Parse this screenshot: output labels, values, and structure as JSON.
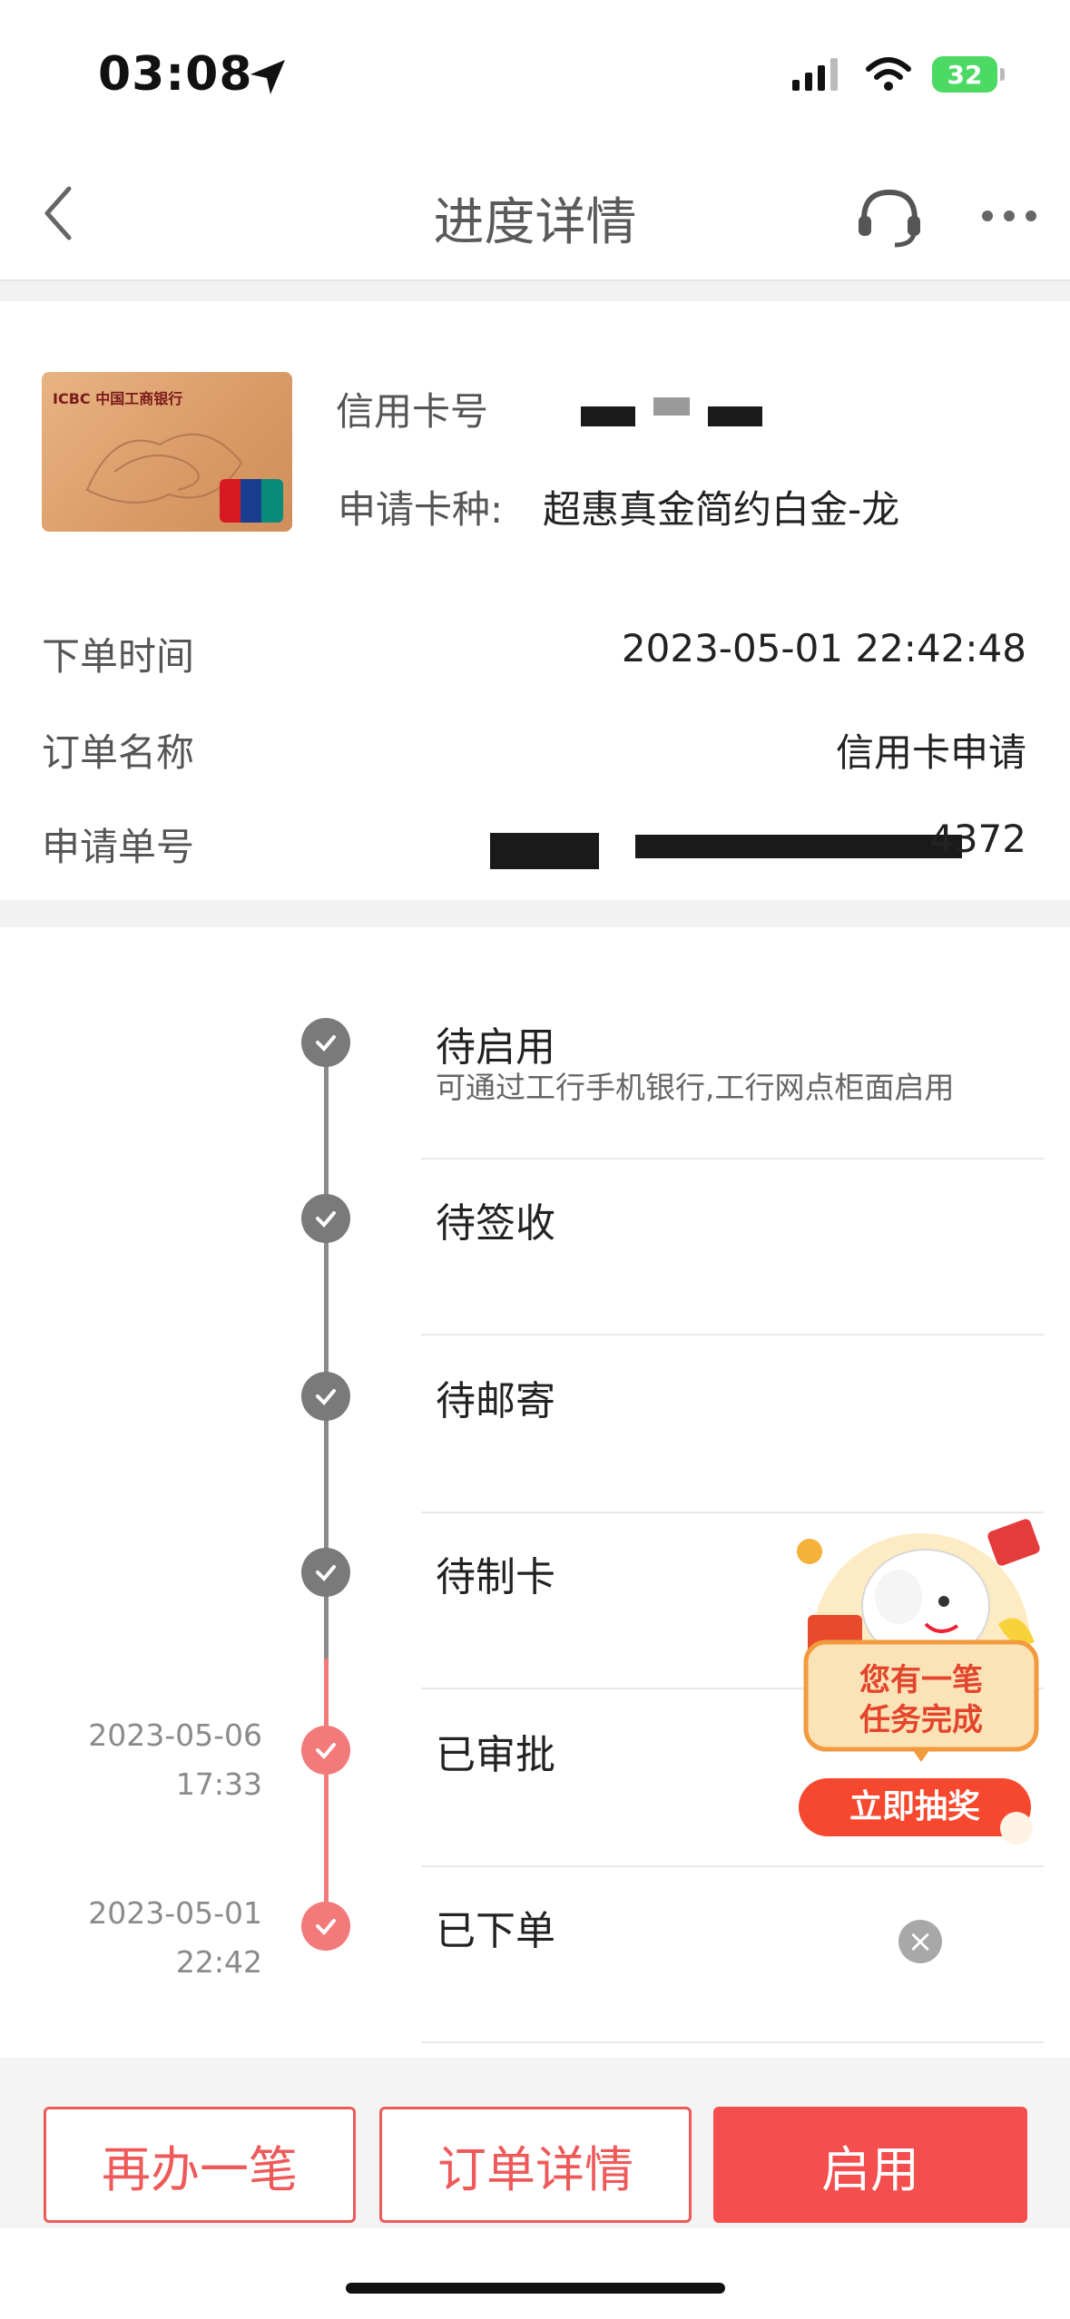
{
  "status_bar": {
    "time": "03:08",
    "battery": "32"
  },
  "nav": {
    "title": "进度详情"
  },
  "card": {
    "number_label": "信用卡号",
    "type_label": "申请卡种:",
    "type_value": "超惠真金简约白金-龙",
    "image_brand": "ICBC 中国工商银行"
  },
  "order": {
    "rows": [
      {
        "label": "下单时间",
        "value": "2023-05-01 22:42:48"
      },
      {
        "label": "订单名称",
        "value": "信用卡申请"
      },
      {
        "label": "申请单号",
        "value": "4372"
      }
    ]
  },
  "timeline": [
    {
      "status": "待启用",
      "desc": "可通过工行手机银行,工行网点柜面启用",
      "date": "",
      "time": "",
      "state": "gray"
    },
    {
      "status": "待签收",
      "desc": "",
      "date": "",
      "time": "",
      "state": "gray"
    },
    {
      "status": "待邮寄",
      "desc": "",
      "date": "",
      "time": "",
      "state": "gray"
    },
    {
      "status": "待制卡",
      "desc": "",
      "date": "",
      "time": "",
      "state": "gray"
    },
    {
      "status": "已审批",
      "desc": "",
      "date": "2023-05-06",
      "time": "17:33",
      "state": "red"
    },
    {
      "status": "已下单",
      "desc": "",
      "date": "2023-05-01",
      "time": "22:42",
      "state": "red"
    }
  ],
  "promo": {
    "line1": "您有一笔",
    "line2": "任务完成",
    "button": "立即抽奖"
  },
  "buttons": {
    "again": "再办一笔",
    "details": "订单详情",
    "activate": "启用"
  },
  "colors": {
    "accent": "#f54e4e",
    "timeline_done": "#f27a7a",
    "timeline_pending": "#7a7a7a"
  }
}
